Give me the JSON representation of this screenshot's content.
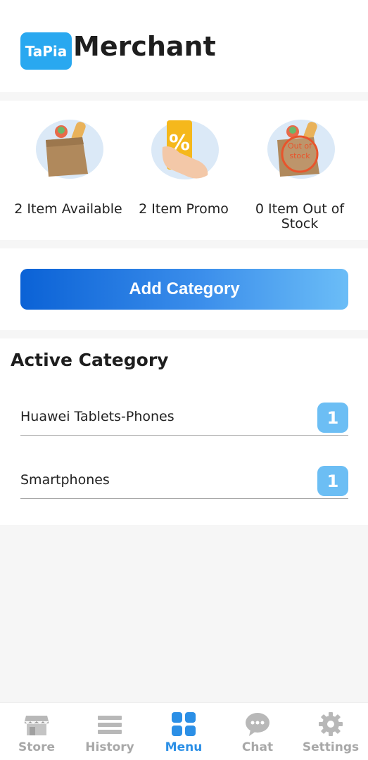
{
  "header": {
    "logo_text": "TaPia",
    "title": "Merchant"
  },
  "stats": [
    {
      "label": "2 Item Available",
      "icon": "grocery-bag-icon"
    },
    {
      "label": "2 Item Promo",
      "icon": "promo-card-icon"
    },
    {
      "label": "0 Item Out of Stock",
      "icon": "out-of-stock-icon",
      "stamp_text": "Out of stock"
    }
  ],
  "actions": {
    "add_category_label": "Add Category"
  },
  "categories": {
    "title": "Active Category",
    "items": [
      {
        "name": "Huawei Tablets-Phones",
        "count": "1"
      },
      {
        "name": "Smartphones",
        "count": "1"
      }
    ]
  },
  "nav": {
    "active": "Menu",
    "items": [
      {
        "label": "Store",
        "icon": "store-icon"
      },
      {
        "label": "History",
        "icon": "history-icon"
      },
      {
        "label": "Menu",
        "icon": "menu-grid-icon"
      },
      {
        "label": "Chat",
        "icon": "chat-icon"
      },
      {
        "label": "Settings",
        "icon": "gear-icon"
      }
    ]
  },
  "colors": {
    "accent": "#2b8fe6",
    "badge": "#6cbef4",
    "inactive": "#a8a8a8"
  }
}
